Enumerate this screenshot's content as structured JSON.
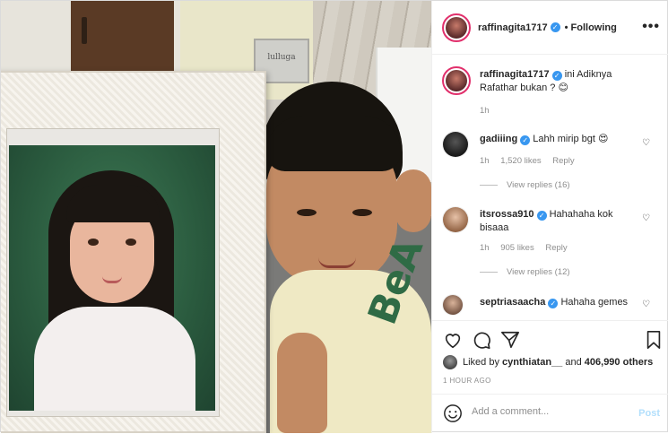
{
  "post": {
    "author": "raffinagita1717",
    "separator": "•",
    "follow_status": "Following",
    "more_label": "•••"
  },
  "photo": {
    "sign_text": "lulluga",
    "shirt_text": "BeA"
  },
  "caption": {
    "username": "raffinagita1717",
    "text": "ini Adiknya Rafathar bukan ? 😊",
    "time": "1h"
  },
  "comments": [
    {
      "username": "gadiiing",
      "text": "Lahh mirip bgt 😍",
      "time": "1h",
      "likes": "1,520 likes",
      "reply": "Reply",
      "view_replies": "View replies (16)"
    },
    {
      "username": "itsrossa910",
      "text": "Hahahaha kok bisaaa",
      "time": "1h",
      "likes": "905 likes",
      "reply": "Reply",
      "view_replies": "View replies (12)"
    },
    {
      "username": "septriasaacha",
      "text": "Hahaha gemes"
    }
  ],
  "likes": {
    "prefix": "Liked by",
    "user": "cynthiatan__",
    "connector": "and",
    "others": "406,990 others"
  },
  "timestamp": "1 HOUR AGO",
  "add_comment": {
    "placeholder": "Add a comment...",
    "post_label": "Post"
  },
  "colors": {
    "verified": "#3897f0",
    "story_ring": "#e1306c",
    "post_disabled": "#b2dffc",
    "muted": "#8e8e8e"
  }
}
